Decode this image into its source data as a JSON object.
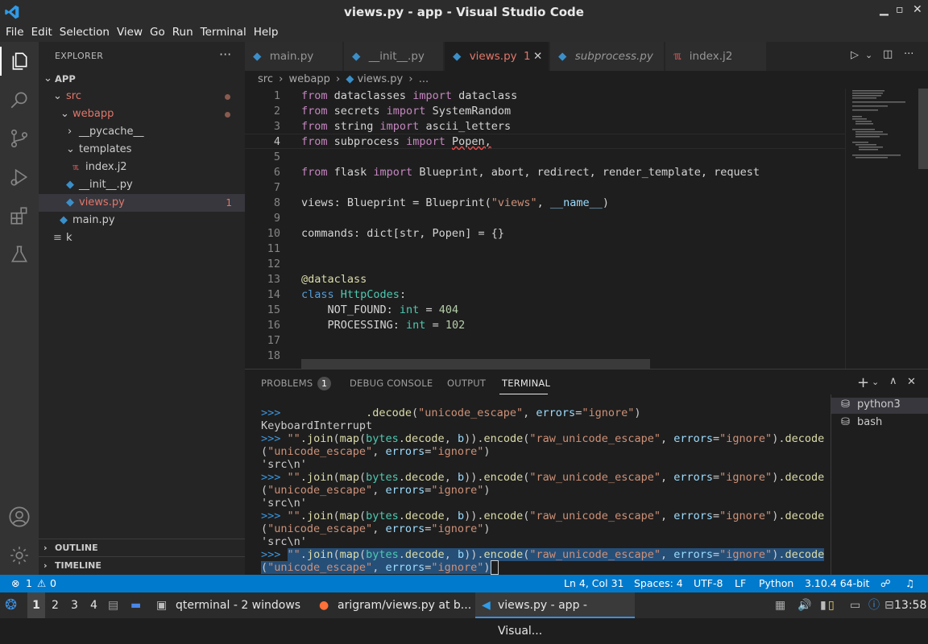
{
  "window": {
    "title": "views.py - app - Visual Studio Code"
  },
  "menu": [
    "File",
    "Edit",
    "Selection",
    "View",
    "Go",
    "Run",
    "Terminal",
    "Help"
  ],
  "sidebar": {
    "title": "EXPLORER",
    "root": "APP",
    "items": [
      {
        "label": "src",
        "badge": ""
      },
      {
        "label": "webapp",
        "badge": ""
      },
      {
        "label": "__pycache__",
        "badge": ""
      },
      {
        "label": "templates",
        "badge": ""
      },
      {
        "label": "index.j2",
        "badge": ""
      },
      {
        "label": "__init__.py",
        "badge": ""
      },
      {
        "label": "views.py",
        "badge": "1"
      },
      {
        "label": "main.py",
        "badge": ""
      },
      {
        "label": "k",
        "badge": ""
      }
    ],
    "outline": "OUTLINE",
    "timeline": "TIMELINE"
  },
  "tabs": [
    {
      "label": "main.py"
    },
    {
      "label": "__init__.py"
    },
    {
      "label": "views.py",
      "badge": "1"
    },
    {
      "label": "subprocess.py"
    },
    {
      "label": "index.j2"
    }
  ],
  "breadcrumb": {
    "a": "src",
    "b": "webapp",
    "c": "views.py",
    "d": "..."
  },
  "editor": {
    "line_numbers": [
      "1",
      "2",
      "3",
      "4",
      "5",
      "6",
      "7",
      "8",
      "9",
      "10",
      "11",
      "12",
      "13",
      "14",
      "15",
      "16",
      "17",
      "18"
    ]
  },
  "panel": {
    "tabs": {
      "problems": "PROBLEMS",
      "problems_count": "1",
      "debug": "DEBUG CONSOLE",
      "output": "OUTPUT",
      "terminal": "TERMINAL"
    },
    "terminals": [
      "python3",
      "bash"
    ],
    "lines": {
      "keyboard_interrupt": "KeyboardInterrupt",
      "result": "'src\\n'"
    }
  },
  "statusbar": {
    "errors": "1",
    "warnings": "0",
    "position": "Ln 4, Col 31",
    "spaces": "Spaces: 4",
    "encoding": "UTF-8",
    "eol": "LF",
    "language": "Python",
    "interpreter": "3.10.4 64-bit"
  },
  "taskbar": {
    "workspaces": [
      "1",
      "2",
      "3",
      "4"
    ],
    "apps": [
      {
        "label": "qterminal - 2 windows"
      },
      {
        "label": "arigram/views.py at b..."
      },
      {
        "label": "views.py - app - Visual..."
      }
    ],
    "clock": "13:58"
  }
}
